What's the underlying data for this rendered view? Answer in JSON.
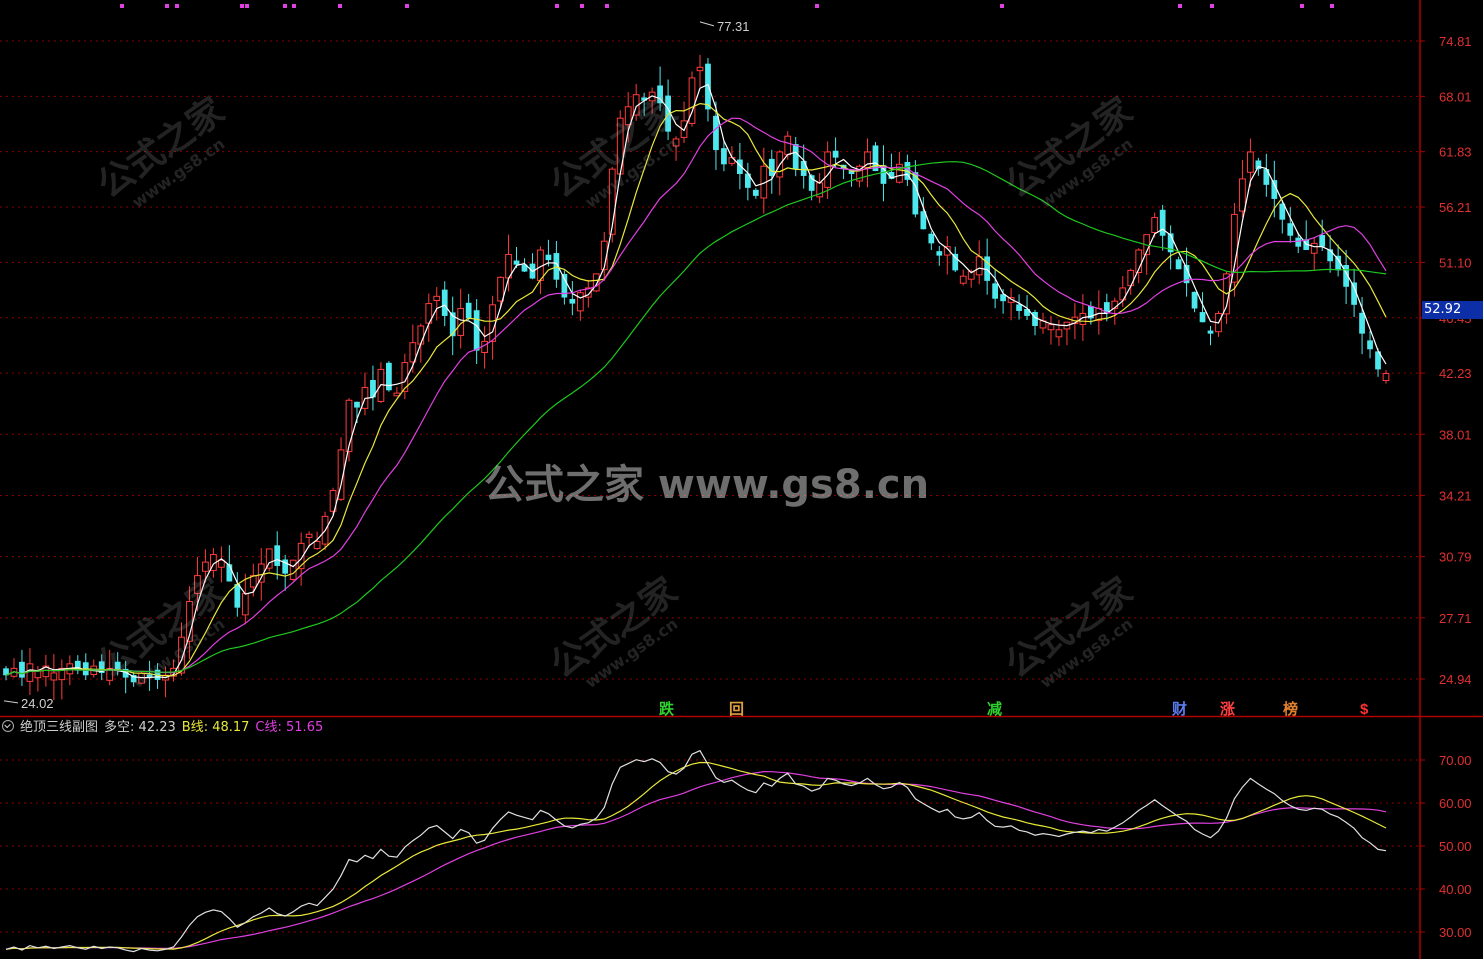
{
  "colors": {
    "background": "#000000",
    "axis": "#b00000",
    "grid": "#8a0000",
    "up": "#ff3b3b",
    "down": "#4de8ee",
    "ma1": "#ffffff",
    "ma2": "#e8e83a",
    "ma3": "#e040e0",
    "ma4": "#1ec81e",
    "tick_text": "#e03030"
  },
  "main_axis": {
    "ticks": [
      "74.81",
      "68.01",
      "61.83",
      "56.21",
      "51.10",
      "46.45",
      "42.23",
      "38.01",
      "34.21",
      "30.79",
      "27.71",
      "24.94"
    ],
    "current_price": "52.92",
    "high_label": "77.31",
    "low_label": "24.02"
  },
  "signals": [
    {
      "label": "跌",
      "color": "#2ed12e"
    },
    {
      "label": "回",
      "color": "#e0a040"
    },
    {
      "label": "减",
      "color": "#2ed12e"
    },
    {
      "label": "财",
      "color": "#5a7cf0"
    },
    {
      "label": "涨",
      "color": "#ff4040"
    },
    {
      "label": "榜",
      "color": "#e08030"
    },
    {
      "label": "$",
      "color": "#ff3030"
    }
  ],
  "indicator": {
    "name": "绝顶三线副图",
    "line_a": {
      "label": "多空",
      "value": "42.23",
      "color": "#e0e0e0"
    },
    "line_b": {
      "label": "B线",
      "value": "48.17",
      "color": "#e8e83a"
    },
    "line_c": {
      "label": "C线",
      "value": "51.65",
      "color": "#e040e0"
    },
    "ticks": [
      "70.00",
      "60.00",
      "50.00",
      "40.00",
      "30.00"
    ]
  },
  "watermark": {
    "center": "公式之家 www.gs8.cn",
    "stamp_main": "公式之家",
    "stamp_url": "www.gs8.cn"
  },
  "chart_data": [
    {
      "type": "candlestick",
      "y_scale": "log",
      "ylim": [
        23.5,
        79.0
      ],
      "notes": "approximate price path (close) with moving averages",
      "close": [
        25.1,
        25.4,
        25.0,
        25.6,
        25.3,
        25.5,
        25.2,
        25.4,
        25.6,
        25.3,
        25.1,
        25.5,
        25.2,
        25.4,
        25.3,
        25.0,
        24.8,
        25.2,
        25.0,
        24.9,
        25.1,
        25.4,
        26.8,
        28.5,
        29.8,
        30.5,
        30.9,
        30.6,
        29.5,
        28.2,
        28.9,
        29.8,
        30.4,
        31.2,
        30.3,
        29.9,
        30.6,
        31.5,
        32.0,
        31.6,
        33.0,
        34.5,
        37.0,
        40.3,
        39.8,
        41.2,
        40.5,
        42.5,
        41.0,
        40.8,
        43.0,
        44.5,
        45.8,
        47.6,
        48.2,
        46.6,
        45.0,
        47.2,
        46.4,
        43.9,
        44.6,
        47.5,
        49.8,
        51.8,
        50.9,
        50.3,
        49.7,
        52.2,
        51.3,
        49.6,
        48.1,
        47.6,
        48.5,
        48.9,
        50.1,
        53.0,
        60.0,
        65.5,
        66.8,
        68.2,
        67.5,
        68.5,
        67.2,
        64.0,
        63.2,
        65.2,
        70.2,
        71.5,
        66.5,
        62.0,
        60.5,
        61.2,
        59.5,
        58.1,
        57.3,
        60.3,
        59.3,
        61.8,
        63.5,
        60.0,
        59.3,
        57.8,
        58.6,
        61.8,
        61.2,
        60.0,
        59.5,
        60.3,
        61.8,
        59.8,
        58.5,
        59.0,
        60.5,
        58.9,
        55.5,
        54.1,
        52.8,
        51.7,
        52.5,
        50.4,
        49.9,
        50.3,
        51.6,
        49.5,
        48.0,
        47.8,
        48.1,
        47.0,
        46.6,
        45.8,
        46.2,
        45.9,
        45.5,
        46.1,
        46.5,
        46.8,
        46.4,
        47.2,
        46.8,
        47.8,
        48.9,
        50.4,
        52.2,
        53.6,
        55.2,
        53.5,
        52.0,
        50.5,
        49.3,
        47.2,
        46.1,
        45.2,
        46.8,
        50.1,
        55.5,
        59.0,
        61.8,
        60.0,
        58.4,
        57.0,
        55.0,
        53.5,
        52.5,
        52.2,
        52.8,
        52.5,
        51.2,
        50.4,
        49.0,
        47.5,
        45.2,
        44.0,
        42.5,
        42.2
      ],
      "ma_periods_note": "four moving averages: white, yellow, magenta, green",
      "ma_colors": [
        "#ffffff",
        "#e8e83a",
        "#e040e0",
        "#1ec81e"
      ]
    },
    {
      "type": "line",
      "name": "绝顶三线副图",
      "ylim": [
        25,
        76
      ],
      "ticks": [
        70,
        60,
        50,
        40,
        30
      ],
      "series": [
        {
          "name": "多空",
          "last": 42.23
        },
        {
          "name": "B线",
          "last": 48.17
        },
        {
          "name": "C线",
          "last": 51.65
        }
      ]
    }
  ]
}
